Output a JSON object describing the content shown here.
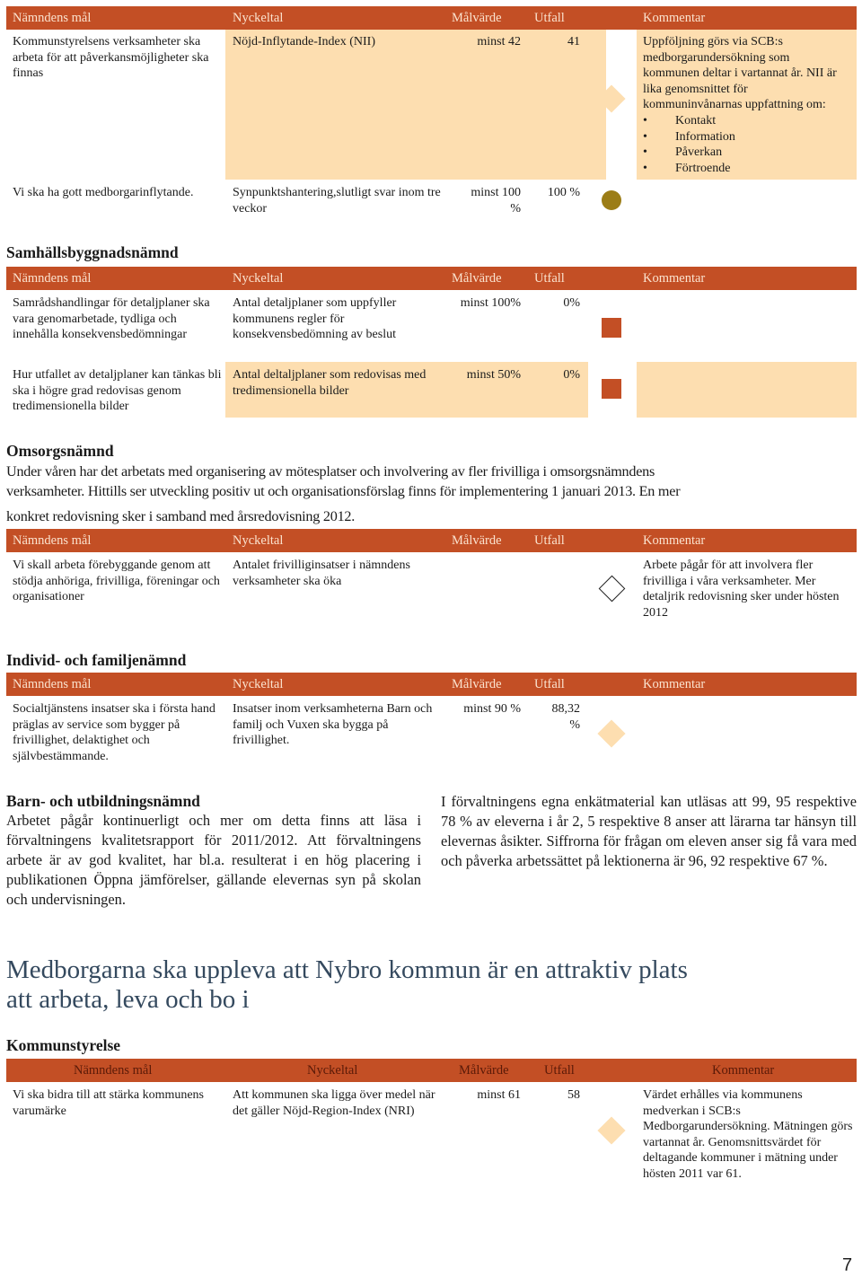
{
  "table_headers": {
    "goal": "Nämndens mål",
    "indicator": "Nyckeltal",
    "target": "Målvärde",
    "outcome": "Utfall",
    "comment": "Kommentar"
  },
  "colors": {
    "header_bg": "#c34f25",
    "row_tan": "#fddeb0",
    "status_diamond": "#fddeb0",
    "status_circle": "#9c7d16",
    "status_square": "#c34f25",
    "title_blue": "#34495e"
  },
  "kommunstyrelse_table_1": {
    "rows": [
      {
        "goal": "Kommunstyrelsens verksamheter ska arbeta för att påverkansmöjligheter ska finnas",
        "indicator": "Nöjd-Inflytande-Index (NII)",
        "target": "minst 42",
        "outcome": "41",
        "status_icon": "diamond-filled",
        "comment": "Uppföljning görs via SCB:s medborgarundersökning som kommunen deltar i vartannat år. NII är lika genomsnittet för kommuninvånarnas uppfattning om:",
        "comment_bullets": [
          "Kontakt",
          "Information",
          "Påverkan",
          "Förtroende"
        ]
      },
      {
        "goal": "Vi ska ha gott medborgarinflytande.",
        "indicator": "Synpunktshantering,slutligt svar inom tre veckor",
        "target": "minst 100 %",
        "outcome": "100 %",
        "status_icon": "circle",
        "comment": ""
      }
    ]
  },
  "samhallsbyggnad": {
    "heading": "Samhällsbyggnadsnämnd",
    "rows": [
      {
        "goal": "Samrådshandlingar för detaljplaner ska vara genomarbetade, tydliga och innehålla konsekvensbedömningar",
        "indicator": "Antal detaljplaner som uppfyller kommunens regler för konsekvensbedömning av beslut",
        "target": "minst 100%",
        "outcome": "0%",
        "status_icon": "square",
        "comment": ""
      },
      {
        "goal": "Hur utfallet av detaljplaner kan tänkas bli ska i högre grad redovisas genom tredimensionella bilder",
        "indicator": "Antal deltaljplaner som redovisas med tredimensionella bilder",
        "target": "minst 50%",
        "outcome": "0%",
        "status_icon": "square",
        "comment": ""
      }
    ]
  },
  "omsorg": {
    "heading": "Omsorgsnämnd",
    "paragraph_lines": [
      "Under våren har det arbetats med organisering av mötesplatser och involvering av fler frivilliga i omsorgsnämndens",
      "verksamheter. Hittills ser utveckling positiv ut och organisationsförslag finns för implementering 1 januari 2013. En mer",
      "konkret redovisning sker i samband med årsredovisning 2012."
    ],
    "rows": [
      {
        "goal": "Vi skall arbeta förebyggande genom att stödja anhöriga, frivilliga, föreningar och organisationer",
        "indicator": "Antalet frivilliginsatser i nämndens verksamheter ska öka",
        "target": "",
        "outcome": "",
        "status_icon": "diamond-outline",
        "comment": "Arbete pågår för att involvera fler frivilliga i våra verksamheter. Mer detaljrik redovisning sker under hösten 2012"
      }
    ]
  },
  "individ": {
    "heading": "Individ- och familjenämnd",
    "rows": [
      {
        "goal": "Socialtjänstens insatser ska i första hand präglas av service som bygger på frivillighet, delaktighet och självbestämmande.",
        "indicator": "Insatser inom verksamheterna Barn och familj och Vuxen ska bygga på frivillighet.",
        "target": "minst 90 %",
        "outcome": "88,32 %",
        "status_icon": "diamond-filled",
        "comment": ""
      }
    ]
  },
  "barn": {
    "heading": "Barn- och utbildningsnämnd",
    "left_text": "Arbetet pågår kontinuerligt och mer om detta finns att läsa i förvaltningens kvalitetsrapport för 2011/2012. Att förvaltningens arbete är av god kvalitet, har bl.a. resulterat i en hög placering i publikationen Öppna jämförelser, gällande elevernas syn på skolan och undervisningen.",
    "right_text": "I förvaltningens egna enkätmaterial kan utläsas att 99, 95 respektive 78 % av eleverna i år 2, 5 respektive 8 anser att lärarna tar hänsyn till elevernas åsikter. Siffrorna för frågan om eleven anser sig få vara med och påverka arbetssättet på lektionerna är 96, 92 respektive 67 %."
  },
  "section_title_lines": [
    "Medborgarna ska uppleva att Nybro kommun är en attraktiv plats",
    "att arbeta, leva och bo i"
  ],
  "kommunstyrelse_2": {
    "heading": "Kommunstyrelse",
    "rows": [
      {
        "goal": "Vi ska bidra till att stärka kommunens varumärke",
        "indicator": "Att kommunen ska ligga över medel när det gäller Nöjd-Region-Index (NRI)",
        "target": "minst 61",
        "outcome": "58",
        "status_icon": "diamond-filled",
        "comment": "Värdet erhålles via kommunens medverkan i SCB:s Medborgarundersökning. Mätningen görs vartannat år. Genomsnittsvärdet för deltagande kommuner i mätning under hösten 2011 var 61."
      }
    ]
  },
  "page_number": "7"
}
